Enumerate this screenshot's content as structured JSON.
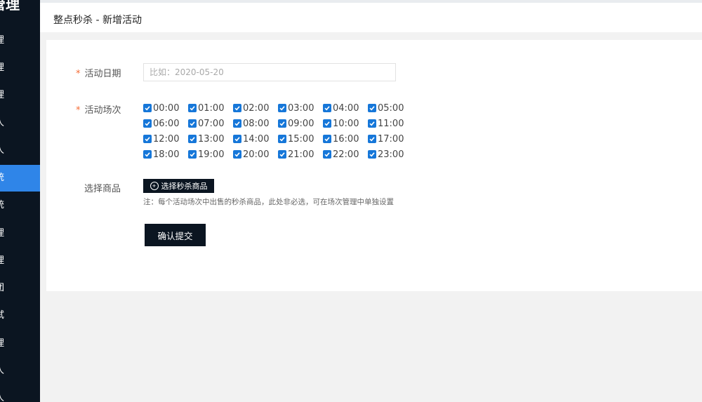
{
  "sidebar": {
    "brand": "管理",
    "items": [
      {
        "label": "理"
      },
      {
        "label": "理"
      },
      {
        "label": "理"
      },
      {
        "label": "人"
      },
      {
        "label": "人"
      },
      {
        "label": "统",
        "active": true
      },
      {
        "label": "统"
      },
      {
        "label": "理"
      },
      {
        "label": "理"
      },
      {
        "label": "团"
      },
      {
        "label": "试"
      },
      {
        "label": "理"
      },
      {
        "label": "人"
      },
      {
        "label": "人"
      }
    ]
  },
  "header": {
    "title": "整点秒杀 - 新增活动"
  },
  "form": {
    "date_label": "活动日期",
    "date_placeholder": "比如：2020-05-20",
    "session_label": "活动场次",
    "sessions": [
      "00:00",
      "01:00",
      "02:00",
      "03:00",
      "04:00",
      "05:00",
      "06:00",
      "07:00",
      "08:00",
      "09:00",
      "10:00",
      "11:00",
      "12:00",
      "13:00",
      "14:00",
      "15:00",
      "16:00",
      "17:00",
      "18:00",
      "19:00",
      "20:00",
      "21:00",
      "22:00",
      "23:00"
    ],
    "goods_label": "选择商品",
    "select_goods_button": "选择秒杀商品",
    "note": "注：每个活动场次中出售的秒杀商品，此处非必选，可在场次管理中单独设置",
    "submit_button": "确认提交",
    "required_mark": "*"
  },
  "colors": {
    "sidebar_bg": "#0b1521",
    "active": "#2f85e8",
    "checkbox": "#1677d9",
    "required": "#f56c36"
  }
}
